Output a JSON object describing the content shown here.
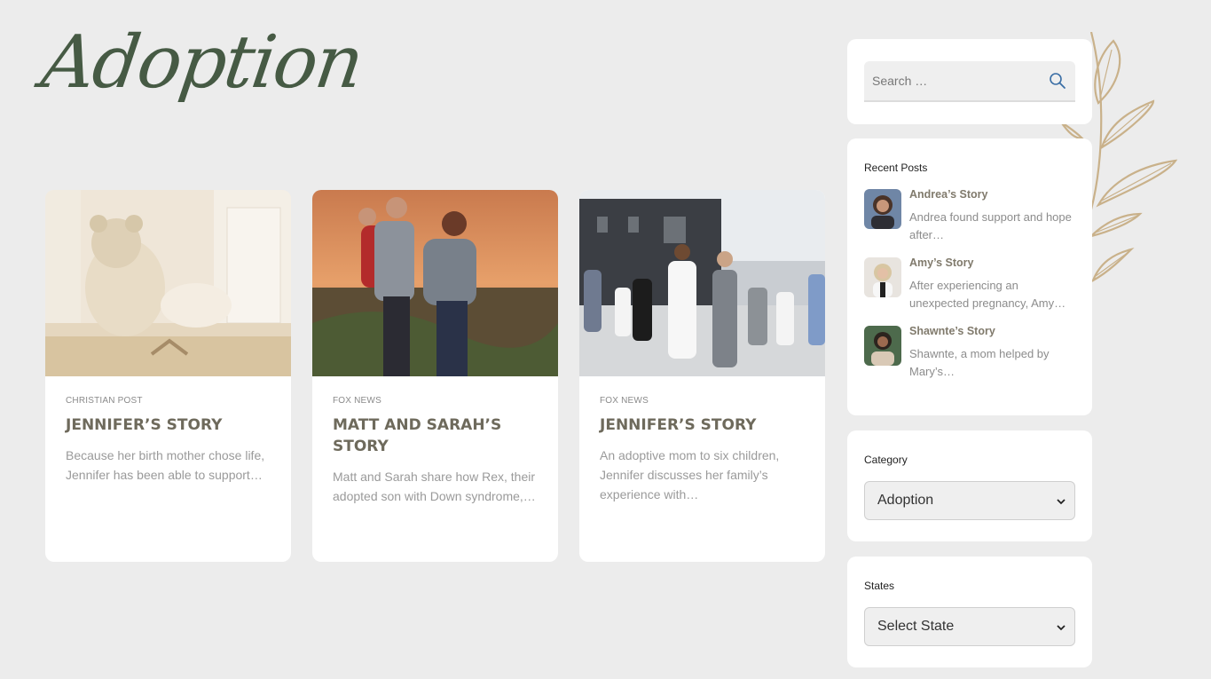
{
  "page": {
    "title": "Adoption"
  },
  "colors": {
    "background": "#ececec",
    "title_green": "#465a44",
    "leaf_gold": "#c9b18a",
    "card_title": "#6e6a5c"
  },
  "cards": [
    {
      "source": "CHRISTIAN POST",
      "title": "JENNIFER’S STORY",
      "excerpt": "Because her birth mother chose life, Jennifer has been able to support…",
      "image": "teddy-bear-photo"
    },
    {
      "source": "FOX NEWS",
      "title": "MATT AND SARAH’S STORY",
      "excerpt": "Matt and Sarah share how Rex, their adopted son with Down syndrome,…",
      "image": "family-sunset-photo"
    },
    {
      "source": "FOX NEWS",
      "title": "JENNIFER’S STORY",
      "excerpt": "An adoptive mom to six children, Jennifer discusses her family’s experience with…",
      "image": "family-walking-photo"
    }
  ],
  "sidebar": {
    "search": {
      "placeholder": "Search …",
      "icon": "search-icon"
    },
    "recent_posts": {
      "title": "Recent Posts",
      "items": [
        {
          "title": "Andrea’s Story",
          "excerpt": "Andrea found support and hope after…"
        },
        {
          "title": "Amy’s Story",
          "excerpt": "After experiencing an unexpected pregnancy, Amy…"
        },
        {
          "title": "Shawnte’s Story",
          "excerpt": "Shawnte, a mom helped by Mary’s…"
        }
      ]
    },
    "category": {
      "title": "Category",
      "selected": "Adoption"
    },
    "states": {
      "title": "States",
      "selected": "Select State"
    }
  }
}
